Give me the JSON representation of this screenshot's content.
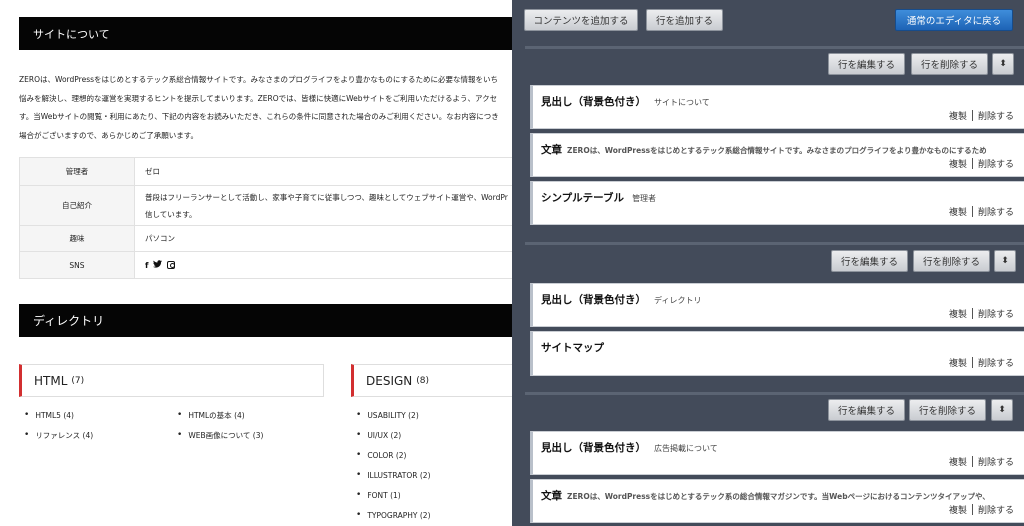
{
  "preview": {
    "section1_title": "サイトについて",
    "intro_lines": [
      "ZEROは、WordPressをはじめとするテック系総合情報サイトです。みなさまのプログライフをより豊かなものにするために必要な情報をいち",
      "悩みを解決し、理想的な運営を実現するヒントを提示してまいります。ZEROでは、皆様に快適にWebサイトをご利用いただけるよう、アクセ",
      "す。当Webサイトの閲覧・利用にあたり、下記の内容をお読みいただき、これらの条件に同意された場合のみご利用ください。なお内容につき",
      "場合がございますので、あらかじめご了承願います。"
    ],
    "profile": [
      {
        "key": "管理者",
        "value": "ゼロ"
      },
      {
        "key": "自己紹介",
        "value_lines": [
          "普段はフリーランサーとして活動し、家事や子育てに従事しつつ、趣味としてウェブサイト運営や、WordPr",
          "信しています。"
        ]
      },
      {
        "key": "趣味",
        "value": "パソコン"
      },
      {
        "key": "SNS",
        "icons": [
          "facebook-icon",
          "twitter-icon",
          "instagram-icon"
        ],
        "facebook_glyph": "f",
        "twitter_glyph": "🐦"
      }
    ],
    "section2_title": "ディレクトリ",
    "categories": [
      {
        "name": "HTML",
        "count": "(7)"
      },
      {
        "name": "DESIGN",
        "count": "(8)"
      }
    ],
    "html_list_col1": [
      "HTML5 (4)",
      "リファレンス (4)"
    ],
    "html_list_col2": [
      "HTMLの基本 (4)",
      "WEB画像について (3)"
    ],
    "design_list": [
      "USABILITY (2)",
      "UI/UX (2)",
      "COLOR (2)",
      "ILLUSTRATOR (2)",
      "FONT (1)",
      "TYPOGRAPHY (2)"
    ]
  },
  "builder": {
    "add_content_label": "コンテンツを追加する",
    "add_row_label": "行を追加する",
    "return_editor_label": "通常のエディタに戻る",
    "edit_row_label": "行を編集する",
    "delete_row_label": "行を削除する",
    "arrow_glyph": "⬍",
    "duplicate_label": "複製",
    "delete_label": "削除する",
    "modules": [
      {
        "title": "見出し（背景色付き）",
        "sub": "サイトについて"
      },
      {
        "title": "文章",
        "sub": "ZEROは、WordPressをはじめとするテック系総合情報サイトです。みなさまのプログライフをより豊かなものにするため"
      },
      {
        "title": "シンプルテーブル",
        "sub": "管理者"
      },
      {
        "title": "見出し（背景色付き）",
        "sub": "ディレクトリ"
      },
      {
        "title": "サイトマップ",
        "sub": ""
      },
      {
        "title": "見出し（背景色付き）",
        "sub": "広告掲載について"
      },
      {
        "title": "文章",
        "sub": "ZEROは、WordPressをはじめとするテック系の総合情報マガジンです。当Webページにおけるコンテンツタイアップや、"
      }
    ]
  }
}
